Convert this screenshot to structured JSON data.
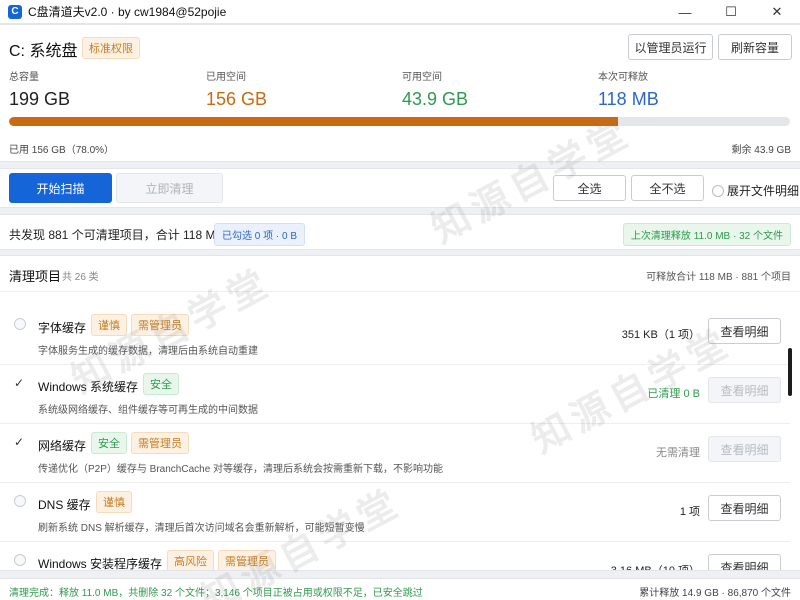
{
  "window": {
    "title": "C盘清道夫v2.0 · by cw1984@52pojie",
    "icon_letter": "C",
    "minimize": "—",
    "maximize": "☐",
    "close": "✕"
  },
  "drive": {
    "title": "C: 系统盘",
    "badge": "标准权限",
    "admin_button": "以管理员运行",
    "refresh_button": "刷新容量",
    "stats": [
      {
        "label": "总容量",
        "value": "199 GB",
        "color": "#222222"
      },
      {
        "label": "已用空间",
        "value": "156 GB",
        "color": "#c96a12"
      },
      {
        "label": "可用空间",
        "value": "43.9 GB",
        "color": "#2f9a4f"
      },
      {
        "label": "本次可释放",
        "value": "118 MB",
        "color": "#2b66c9"
      }
    ],
    "used_percent": 78.0,
    "used_text": "已用 156 GB（78.0%）",
    "remain_text": "剩余 43.9 GB"
  },
  "toolbar": {
    "scan_label": "开始扫描",
    "clean_label": "立即清理",
    "select_all_label": "全选",
    "select_none_label": "全不选",
    "expand_label": "展开文件明细"
  },
  "summary": {
    "found_text": "共发现 881 个可清理项目，合计 118 MB",
    "selected_text": "已勾选 0 项 · 0 B",
    "last_text": "上次清理释放 11.0 MB · 32 个文件"
  },
  "list": {
    "title": "清理项目",
    "count": "共 26 类",
    "total": "可释放合计 118 MB · 881 个项目",
    "items": [
      {
        "name": "字体缓存",
        "checked": false,
        "badges": [
          {
            "text": "谨慎",
            "kind": "orange"
          },
          {
            "text": "需管理员",
            "kind": "orange"
          }
        ],
        "desc": "字体服务生成的缓存数据，清理后由系统自动重建",
        "status": "351 KB（1 项）",
        "status_color": "#222222",
        "button": "查看明细",
        "button_disabled": false
      },
      {
        "name": "Windows 系统缓存",
        "checked": true,
        "badges": [
          {
            "text": "安全",
            "kind": "green"
          }
        ],
        "desc": "系统级网络缓存、组件缓存等可再生成的中间数据",
        "status": "已清理 0 B",
        "status_color": "#2f9a4f",
        "button": "查看明细",
        "button_disabled": true
      },
      {
        "name": "网络缓存",
        "checked": true,
        "badges": [
          {
            "text": "安全",
            "kind": "green"
          },
          {
            "text": "需管理员",
            "kind": "orange"
          }
        ],
        "desc": "传递优化（P2P）缓存与 BranchCache 对等缓存，清理后系统会按需重新下载，不影响功能",
        "status": "无需清理",
        "status_color": "#888888",
        "button": "查看明细",
        "button_disabled": true
      },
      {
        "name": "DNS 缓存",
        "checked": false,
        "badges": [
          {
            "text": "谨慎",
            "kind": "orange"
          }
        ],
        "desc": "刷新系统 DNS 解析缓存，清理后首次访问域名会重新解析，可能短暂变慢",
        "status": "1 项",
        "status_color": "#222222",
        "button": "查看明细",
        "button_disabled": false
      },
      {
        "name": "Windows 安装程序缓存",
        "checked": false,
        "badges": [
          {
            "text": "高风险",
            "kind": "orange"
          },
          {
            "text": "需管理员",
            "kind": "orange"
          }
        ],
        "desc": "",
        "status": "3.16 MB（10 项）",
        "status_color": "#222222",
        "button": "查看明细",
        "button_disabled": false
      }
    ]
  },
  "statusbar": {
    "left": "清理完成：释放 11.0 MB，共删除 32 个文件；3,146 个项目正被占用或权限不足，已安全跳过",
    "right": "累计释放 14.9 GB · 86,870 个文件"
  },
  "watermark": "知源自学堂",
  "colors": {
    "accent": "#1565d8",
    "used": "#c96a12",
    "free": "#2f9a4f",
    "release": "#2b66c9"
  }
}
